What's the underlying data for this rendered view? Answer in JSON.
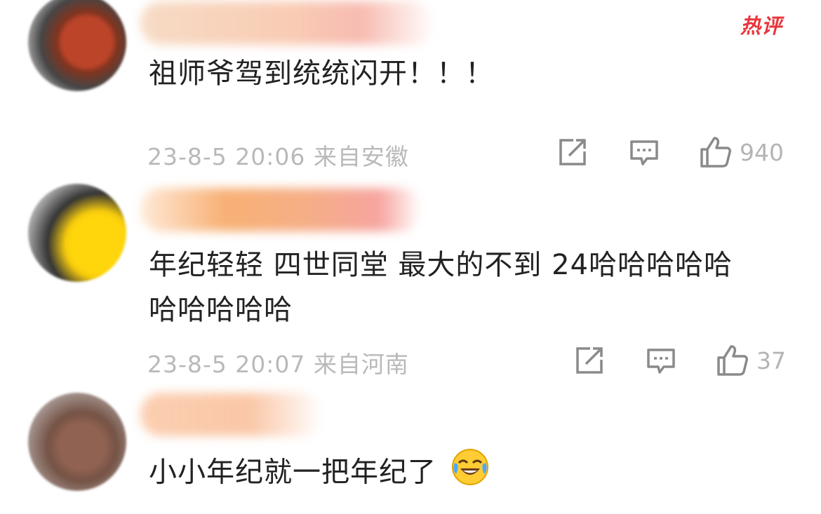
{
  "hot_badge": "热评",
  "comments": [
    {
      "text": "祖师爷驾到统统闪开！！！",
      "time": "23-8-5 20:06",
      "location": "来自安徽",
      "meta": "23-8-5 20:06 来自安徽",
      "likes": "940"
    },
    {
      "text_line1": "年纪轻轻 四世同堂 最大的不到 24哈哈哈哈哈",
      "text_line2": "哈哈哈哈哈",
      "meta": "23-8-5 20:07 来自河南",
      "likes": "37"
    },
    {
      "text": "小小年纪就一把年纪了",
      "emoji": "laughing-crying-emoji"
    }
  ],
  "icons": {
    "share": "share-icon",
    "comment": "comment-icon",
    "like": "thumbs-up-icon"
  },
  "colors": {
    "accent": "#e8363b",
    "text": "#222222",
    "meta": "#b9b9b9"
  }
}
